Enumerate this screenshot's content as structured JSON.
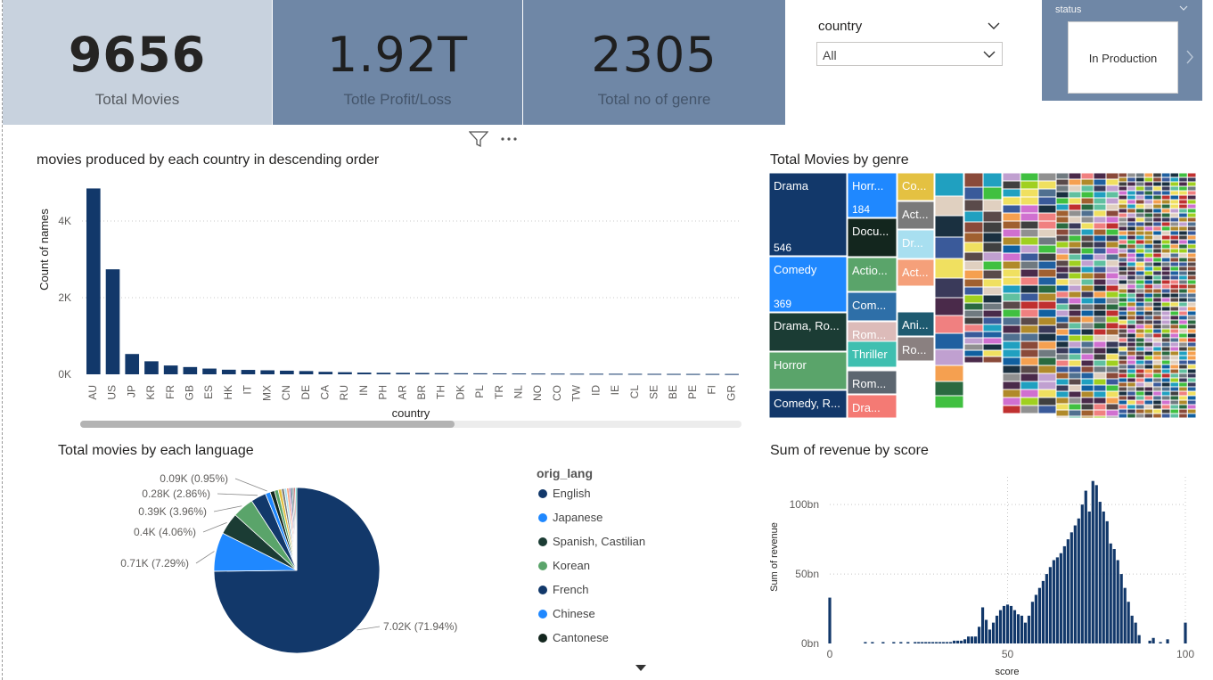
{
  "kpis": [
    {
      "value": "9656",
      "label": "Total Movies"
    },
    {
      "value": "1.92T",
      "label": "Totle  Profit/Loss"
    },
    {
      "value": "2305",
      "label": "Total no of genre"
    }
  ],
  "slicer": {
    "title": "country",
    "selected": "All"
  },
  "status": {
    "title": "status",
    "value": "In Production"
  },
  "toolbar": {
    "filter_icon": "filter-icon",
    "more_icon": "more-options-icon"
  },
  "colors": {
    "primary": "#12386a",
    "secondary": "#1f88ff",
    "kpi_light": "#c8d2de",
    "kpi_dark": "#6f87a6"
  },
  "bar_chart": {
    "title": "movies produced by each country in descending order",
    "chart_data": {
      "type": "bar",
      "title": "movies produced by each country in descending order",
      "xlabel": "country",
      "ylabel": "Count of names",
      "ylim": [
        0,
        5000
      ],
      "yticks": [
        "0K",
        "2K",
        "4K"
      ],
      "categories": [
        "AU",
        "US",
        "JP",
        "KR",
        "FR",
        "GB",
        "ES",
        "HK",
        "IT",
        "MX",
        "CN",
        "DE",
        "CA",
        "RU",
        "IN",
        "PH",
        "AR",
        "BR",
        "TH",
        "DK",
        "PL",
        "TR",
        "NL",
        "NO",
        "CO",
        "TW",
        "ID",
        "IE",
        "CL",
        "SE",
        "BE",
        "PE",
        "FI",
        "GR"
      ],
      "values": [
        4850,
        2740,
        530,
        340,
        230,
        190,
        150,
        120,
        115,
        105,
        95,
        85,
        65,
        55,
        45,
        40,
        38,
        35,
        30,
        28,
        26,
        24,
        22,
        20,
        18,
        16,
        15,
        14,
        13,
        12,
        11,
        10,
        10,
        9
      ],
      "grid": true
    }
  },
  "treemap": {
    "title": "Total Movies by genre",
    "chart_data": {
      "type": "treemap",
      "items": [
        {
          "label": "Drama",
          "value": 546,
          "color": "#12386a"
        },
        {
          "label": "Comedy",
          "value": 369,
          "color": "#1f88ff"
        },
        {
          "label": "Drama, Ro...",
          "value": 150,
          "color": "#1b3c34"
        },
        {
          "label": "Horror",
          "value": 140,
          "color": "#5aa46a"
        },
        {
          "label": "Comedy, R...",
          "value": 110,
          "color": "#12386a"
        },
        {
          "label": "Horr...",
          "value": 184,
          "color": "#1f88ff"
        },
        {
          "label": "Docu...",
          "value": 170,
          "color": "#13261e"
        },
        {
          "label": "Actio...",
          "value": 120,
          "color": "#5aa46a"
        },
        {
          "label": "Com...",
          "value": 110,
          "color": "#2e6fa8"
        },
        {
          "label": "Rom...",
          "value": 95,
          "color": "#dcbbb9"
        },
        {
          "label": "Thriller",
          "value": 90,
          "color": "#3fbfb0"
        },
        {
          "label": "Rom...",
          "value": 85,
          "color": "#5c6670"
        },
        {
          "label": "Dra...",
          "value": 80,
          "color": "#f47a74"
        },
        {
          "label": "Co...",
          "value": 70,
          "color": "#e4c142"
        },
        {
          "label": "Act...",
          "value": 65,
          "color": "#7a7a7a"
        },
        {
          "label": "Dr...",
          "value": 60,
          "color": "#a8dff0"
        },
        {
          "label": "Act...",
          "value": 60,
          "color": "#f5a07a"
        },
        {
          "label": "Ani...",
          "value": 55,
          "color": "#1e5a70"
        },
        {
          "label": "Ro...",
          "value": 50,
          "color": "#8a8080"
        }
      ],
      "show_value_for": [
        "Drama",
        "Comedy",
        "Horr..."
      ]
    }
  },
  "pie_chart": {
    "title": "Total movies by each language",
    "legend_title": "orig_lang",
    "chart_data": {
      "type": "pie",
      "slices": [
        {
          "name": "English",
          "value": 7020,
          "label": "7.02K (71.94%)",
          "color": "#12386a"
        },
        {
          "name": "Japanese",
          "value": 710,
          "label": "0.71K (7.29%)",
          "color": "#1f88ff"
        },
        {
          "name": "Spanish, Castilian",
          "value": 400,
          "label": "0.4K (4.06%)",
          "color": "#1b3c34"
        },
        {
          "name": "Korean",
          "value": 390,
          "label": "0.39K (3.96%)",
          "color": "#5aa46a"
        },
        {
          "name": "French",
          "value": 280,
          "label": "0.28K (2.86%)",
          "color": "#12386a"
        },
        {
          "name": "Chinese",
          "value": 90,
          "label": "0.09K (0.95%)",
          "color": "#1f88ff"
        },
        {
          "name": "Cantonese",
          "value": 80,
          "label": "",
          "color": "#13261e"
        },
        {
          "name": "",
          "value": 70,
          "label": "",
          "color": "#5aa46a"
        },
        {
          "name": "",
          "value": 60,
          "label": "",
          "color": "#e4c142"
        },
        {
          "name": "",
          "value": 50,
          "label": "",
          "color": "#7a7a7a"
        },
        {
          "name": "",
          "value": 45,
          "label": "",
          "color": "#a8dff0"
        },
        {
          "name": "",
          "value": 40,
          "label": "",
          "color": "#f5a07a"
        },
        {
          "name": "",
          "value": 35,
          "label": "",
          "color": "#b07ab0"
        },
        {
          "name": "",
          "value": 30,
          "label": "",
          "color": "#1e5a70"
        },
        {
          "name": "",
          "value": 30,
          "label": "",
          "color": "#8a8080"
        },
        {
          "name": "",
          "value": 25,
          "label": "",
          "color": "#c23b3b"
        },
        {
          "name": "",
          "value": 25,
          "label": "",
          "color": "#3fbfb0"
        }
      ],
      "legend": [
        "English",
        "Japanese",
        "Spanish, Castilian",
        "Korean",
        "French",
        "Chinese",
        "Cantonese"
      ]
    }
  },
  "histogram": {
    "title": "Sum of revenue by score",
    "chart_data": {
      "type": "bar",
      "title": "Sum of revenue by score",
      "xlabel": "score",
      "ylabel": "Sum of revenue",
      "xlim": [
        0,
        100
      ],
      "ylim": [
        0,
        120
      ],
      "yticks": [
        "0bn",
        "50bn",
        "100bn"
      ],
      "xticks": [
        "0",
        "50",
        "100"
      ],
      "unit": "bn",
      "x": [
        0,
        10,
        12,
        15,
        18,
        20,
        22,
        24,
        25,
        26,
        27,
        28,
        29,
        30,
        31,
        32,
        33,
        34,
        35,
        36,
        37,
        38,
        39,
        40,
        41,
        42,
        43,
        44,
        45,
        46,
        47,
        48,
        49,
        50,
        51,
        52,
        53,
        54,
        55,
        56,
        57,
        58,
        59,
        60,
        61,
        62,
        63,
        64,
        65,
        66,
        67,
        68,
        69,
        70,
        71,
        72,
        73,
        74,
        75,
        76,
        77,
        78,
        79,
        80,
        81,
        82,
        83,
        84,
        85,
        86,
        87,
        90,
        91,
        93,
        95,
        100
      ],
      "values": [
        33,
        1,
        1,
        1,
        1,
        1,
        1,
        1,
        1,
        1,
        1,
        1,
        1,
        1,
        1,
        1,
        1,
        1,
        2,
        2,
        2,
        3,
        5,
        5,
        5,
        12,
        26,
        17,
        10,
        15,
        20,
        24,
        27,
        28,
        27,
        24,
        21,
        20,
        15,
        20,
        30,
        35,
        40,
        45,
        50,
        55,
        60,
        62,
        65,
        70,
        75,
        80,
        85,
        90,
        100,
        110,
        95,
        117,
        114,
        102,
        95,
        88,
        72,
        68,
        60,
        50,
        40,
        30,
        20,
        15,
        6,
        2,
        4,
        1,
        3,
        15
      ]
    }
  }
}
